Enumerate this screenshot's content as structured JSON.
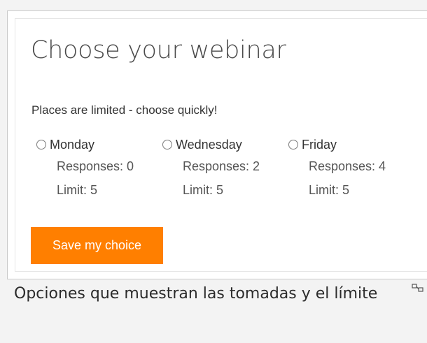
{
  "form": {
    "title": "Choose your webinar",
    "subtitle": "Places are limited - choose quickly!",
    "options": [
      {
        "label": "Monday",
        "responses": "Responses: 0",
        "limit": "Limit: 5",
        "selected": false
      },
      {
        "label": "Wednesday",
        "responses": "Responses: 2",
        "limit": "Limit: 5",
        "selected": false
      },
      {
        "label": "Friday",
        "responses": "Responses: 4",
        "limit": "Limit: 5",
        "selected": false
      }
    ],
    "save_label": "Save my choice"
  },
  "caption": {
    "text": "Opciones que muestran las tomadas y el límite",
    "icon": "resize-icon"
  },
  "colors": {
    "accent": "#ff7f00",
    "text": "#333333",
    "page_bg": "#f3f3f3",
    "card_bg": "#ffffff"
  }
}
